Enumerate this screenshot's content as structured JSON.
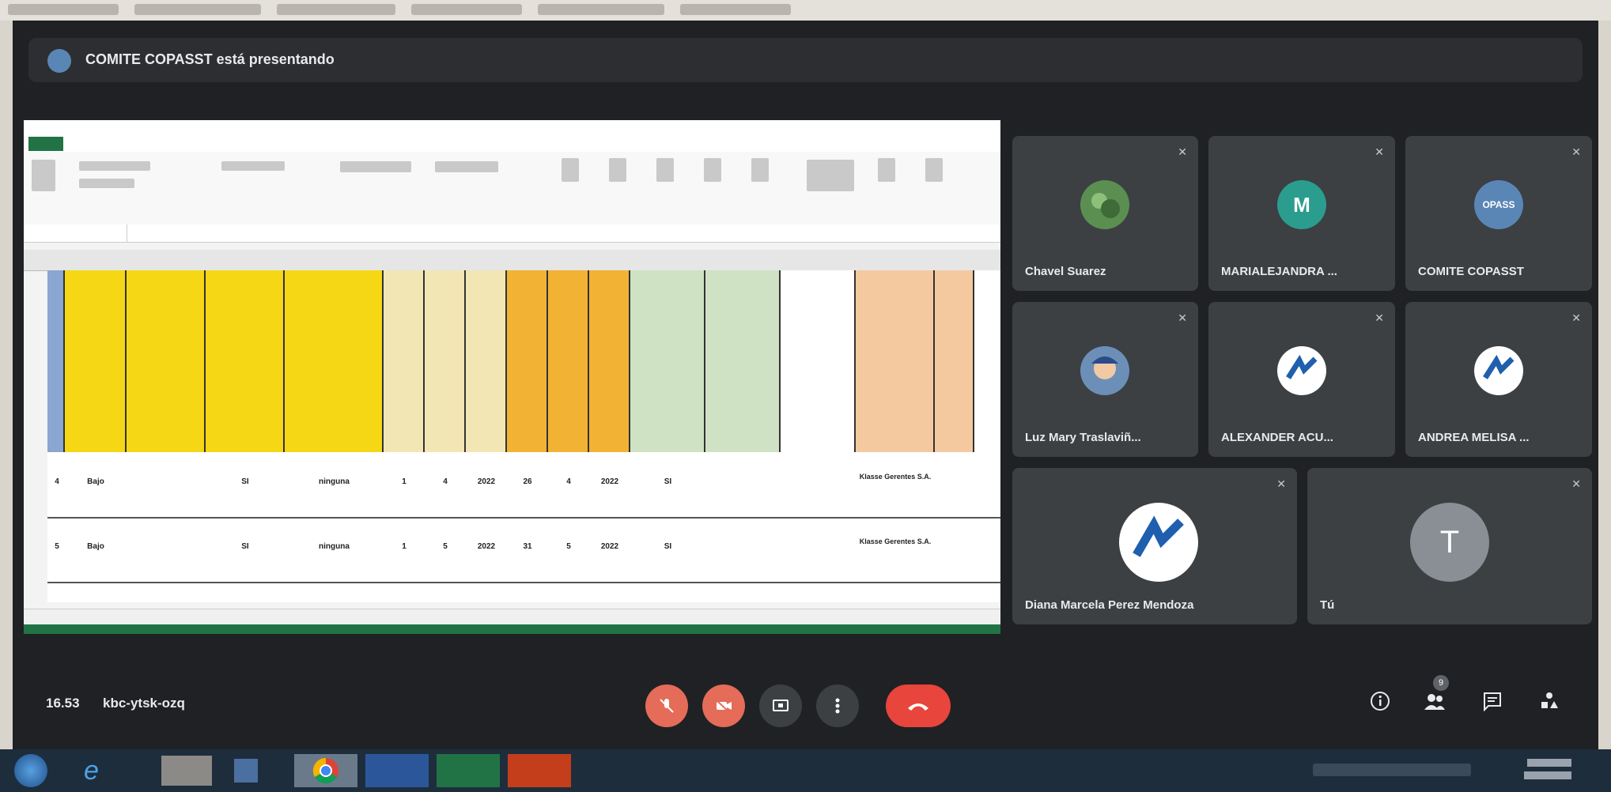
{
  "meeting": {
    "presenter_banner": "COMITE COPASST está presentando",
    "clock": "16.53",
    "meeting_code": "kbc-ytsk-ozq"
  },
  "participants": [
    {
      "name": "Chavel Suarez",
      "avatar": "leaf photo avatar",
      "avatar_color": "#5b8f52"
    },
    {
      "name": "MARIALEJANDRA ...",
      "avatar_letter": "M",
      "avatar_color": "#2a9d8f"
    },
    {
      "name": "COMITE COPASST",
      "avatar_text": "OPASS",
      "avatar_color": "#5a86b6"
    },
    {
      "name": "Luz Mary Traslaviñ...",
      "avatar": "cartoon photo avatar",
      "avatar_color": "#6c8fb8"
    },
    {
      "name": "ALEXANDER ACU...",
      "avatar": "company logo avatar",
      "avatar_color": "#ffffff"
    },
    {
      "name": "ANDREA MELISA ...",
      "avatar": "company logo avatar",
      "avatar_color": "#ffffff"
    },
    {
      "name": "Diana Marcela Perez Mendoza",
      "avatar": "company logo avatar",
      "avatar_color": "#ffffff"
    },
    {
      "name": "Tú",
      "avatar_letter": "T",
      "avatar_color": "#8a8f96"
    }
  ],
  "spreadsheet": {
    "row1": {
      "a": "4",
      "b": "Bajo",
      "d": "SI",
      "e": "ninguna",
      "f": "1",
      "g": "4",
      "h": "2022",
      "i": "26",
      "j": "4",
      "k": "2022",
      "l": "SI",
      "p": "Klasse Gerentes S.A."
    },
    "row2": {
      "a": "5",
      "b": "Bajo",
      "d": "SI",
      "e": "ninguna",
      "f": "1",
      "g": "5",
      "h": "2022",
      "i": "31",
      "j": "5",
      "k": "2022",
      "l": "SI",
      "p": "Klasse Gerentes S.A."
    }
  },
  "controls": {
    "info_icon": "info-icon",
    "people_icon": "people-icon",
    "people_count": "9",
    "chat_icon": "chat-icon",
    "activities_icon": "activities-icon"
  },
  "colors": {
    "header_yellow": "#f5d715",
    "header_cream": "#f2e6b5",
    "header_orange": "#f2b233",
    "header_green": "#cfe3c4",
    "header_peach": "#f4c9a0",
    "leave_red": "#e8453c",
    "mute_red": "#e46c59",
    "excel_green": "#217346"
  }
}
